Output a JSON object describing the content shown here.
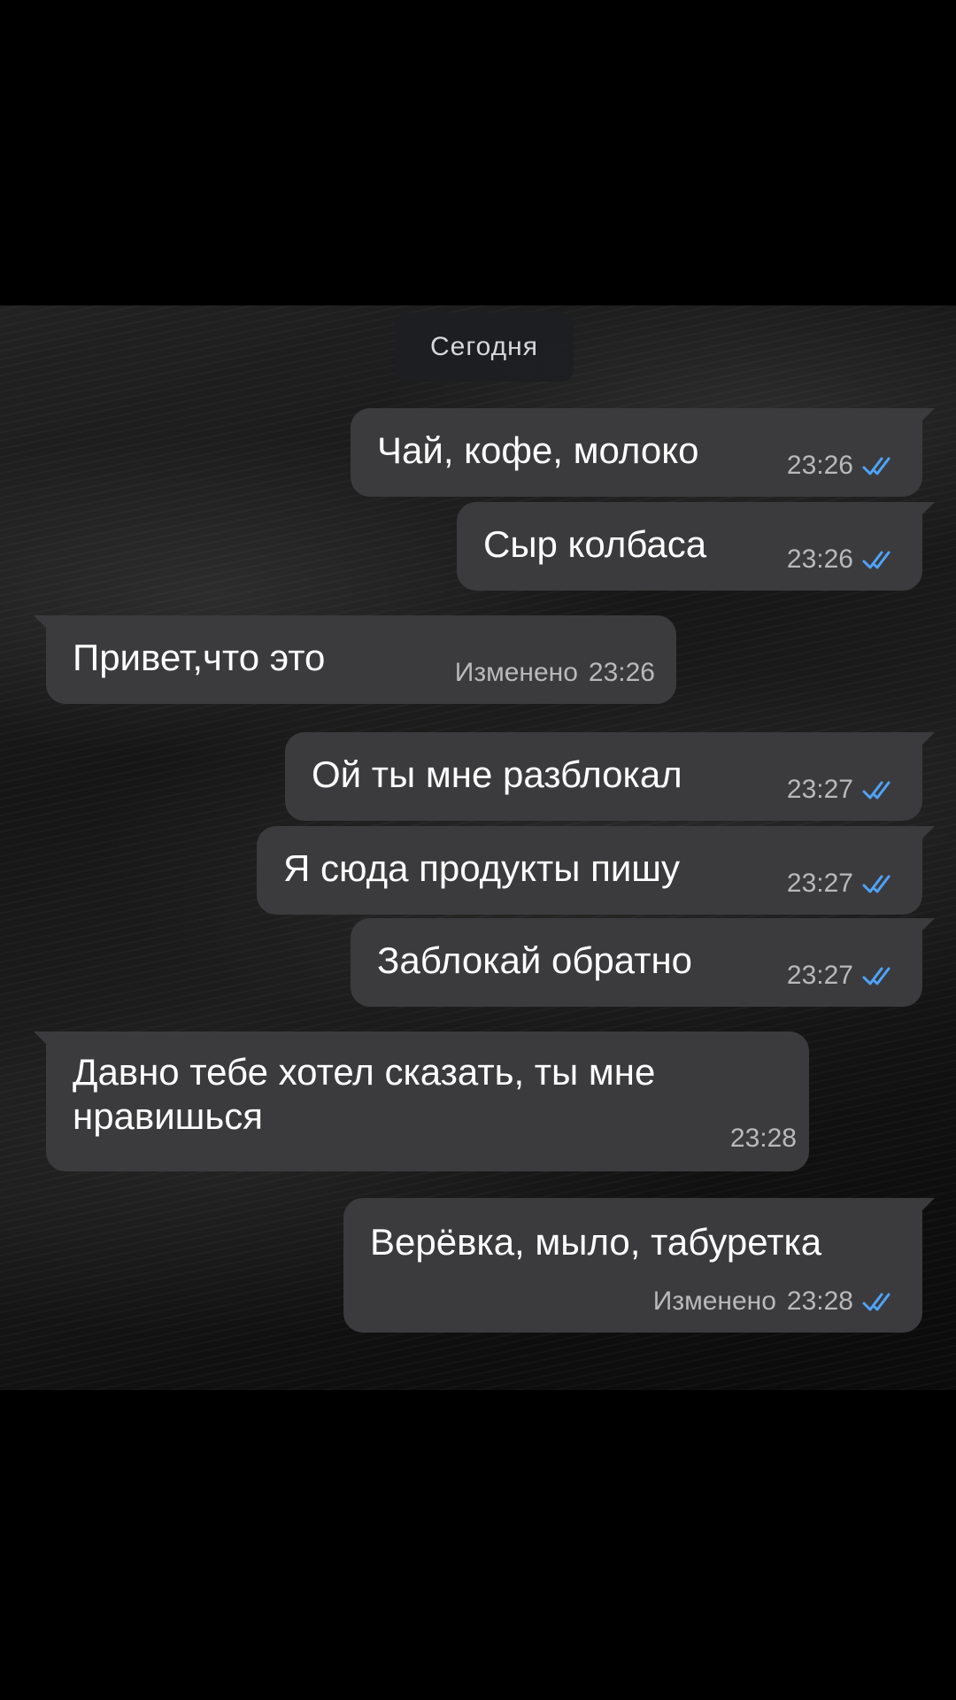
{
  "chat": {
    "date_label": "Сегодня",
    "check_color": "#4fa3f7",
    "messages": [
      {
        "direction": "outgoing",
        "text": "Чай, кофе, молоко",
        "edited_label": "",
        "time": "23:26",
        "read": true
      },
      {
        "direction": "outgoing",
        "text": "Сыр колбаса",
        "edited_label": "",
        "time": "23:26",
        "read": true
      },
      {
        "direction": "incoming",
        "text": "Привет,что это",
        "edited_label": "Изменено",
        "time": "23:26",
        "read": false
      },
      {
        "direction": "outgoing",
        "text": "Ой ты мне разблокал",
        "edited_label": "",
        "time": "23:27",
        "read": true
      },
      {
        "direction": "outgoing",
        "text": "Я сюда продукты пишу",
        "edited_label": "",
        "time": "23:27",
        "read": true
      },
      {
        "direction": "outgoing",
        "text": "Заблокай обратно",
        "edited_label": "",
        "time": "23:27",
        "read": true
      },
      {
        "direction": "incoming",
        "text_line1": "Давно тебе хотел сказать, ты мне",
        "text_line2": "нравишься",
        "edited_label": "",
        "time": "23:28",
        "read": false
      },
      {
        "direction": "outgoing",
        "text": "Верёвка, мыло, табуретка",
        "edited_label": "Изменено",
        "time": "23:28",
        "read": true
      }
    ]
  }
}
